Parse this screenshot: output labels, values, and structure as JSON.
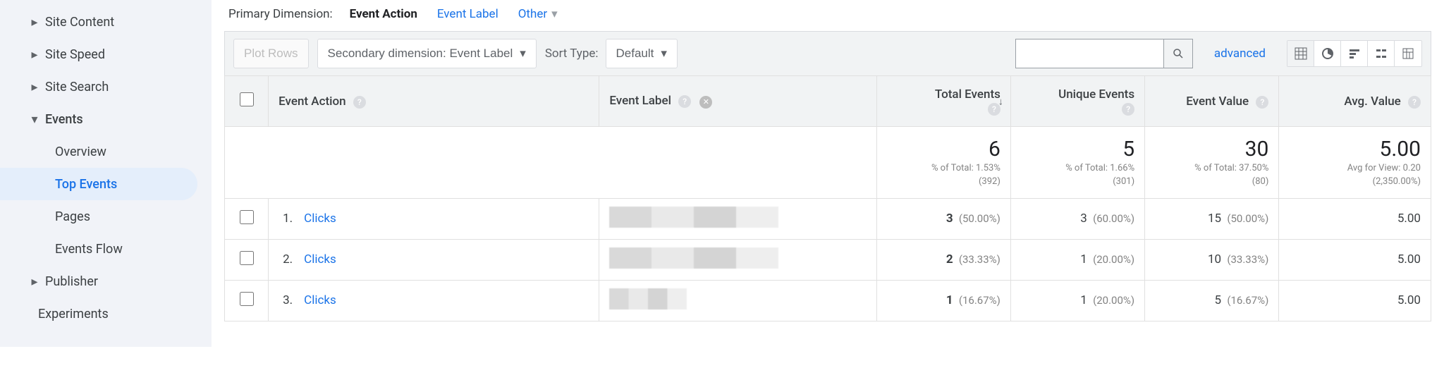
{
  "sidebar": {
    "items": [
      {
        "label": "Site Content",
        "expandable": true
      },
      {
        "label": "Site Speed",
        "expandable": true
      },
      {
        "label": "Site Search",
        "expandable": true
      },
      {
        "label": "Events",
        "expandable": true,
        "expanded": true
      },
      {
        "label": "Publisher",
        "expandable": true
      }
    ],
    "eventsChildren": [
      {
        "label": "Overview"
      },
      {
        "label": "Top Events",
        "active": true
      },
      {
        "label": "Pages"
      },
      {
        "label": "Events Flow"
      }
    ],
    "plain": {
      "label": "Experiments"
    }
  },
  "dimension": {
    "label": "Primary Dimension:",
    "options": [
      {
        "label": "Event Action",
        "active": true
      },
      {
        "label": "Event Label"
      },
      {
        "label": "Other"
      }
    ]
  },
  "toolbar": {
    "plotRows": "Plot Rows",
    "secondary": "Secondary dimension: Event Label",
    "sortTypeLabel": "Sort Type:",
    "sortTypeValue": "Default",
    "advanced": "advanced"
  },
  "columns": {
    "c1": "Event Action",
    "c2": "Event Label",
    "c3": "Total Events",
    "c4": "Unique Events",
    "c5": "Event Value",
    "c6": "Avg. Value"
  },
  "summary": {
    "totalEvents": {
      "value": "6",
      "sub1": "% of Total: 1.53%",
      "sub2": "(392)"
    },
    "uniqueEvents": {
      "value": "5",
      "sub1": "% of Total: 1.66%",
      "sub2": "(301)"
    },
    "eventValue": {
      "value": "30",
      "sub1": "% of Total: 37.50%",
      "sub2": "(80)"
    },
    "avgValue": {
      "value": "5.00",
      "sub1": "Avg for View: 0.20",
      "sub2": "(2,350.00%)"
    }
  },
  "rows": [
    {
      "idx": "1.",
      "action": "Clicks",
      "total": "3",
      "totalPct": "(50.00%)",
      "unique": "3",
      "uniquePct": "(60.00%)",
      "value": "15",
      "valuePct": "(50.00%)",
      "avg": "5.00"
    },
    {
      "idx": "2.",
      "action": "Clicks",
      "total": "2",
      "totalPct": "(33.33%)",
      "unique": "1",
      "uniquePct": "(20.00%)",
      "value": "10",
      "valuePct": "(33.33%)",
      "avg": "5.00"
    },
    {
      "idx": "3.",
      "action": "Clicks",
      "total": "1",
      "totalPct": "(16.67%)",
      "unique": "1",
      "uniquePct": "(20.00%)",
      "value": "5",
      "valuePct": "(16.67%)",
      "avg": "5.00"
    }
  ]
}
